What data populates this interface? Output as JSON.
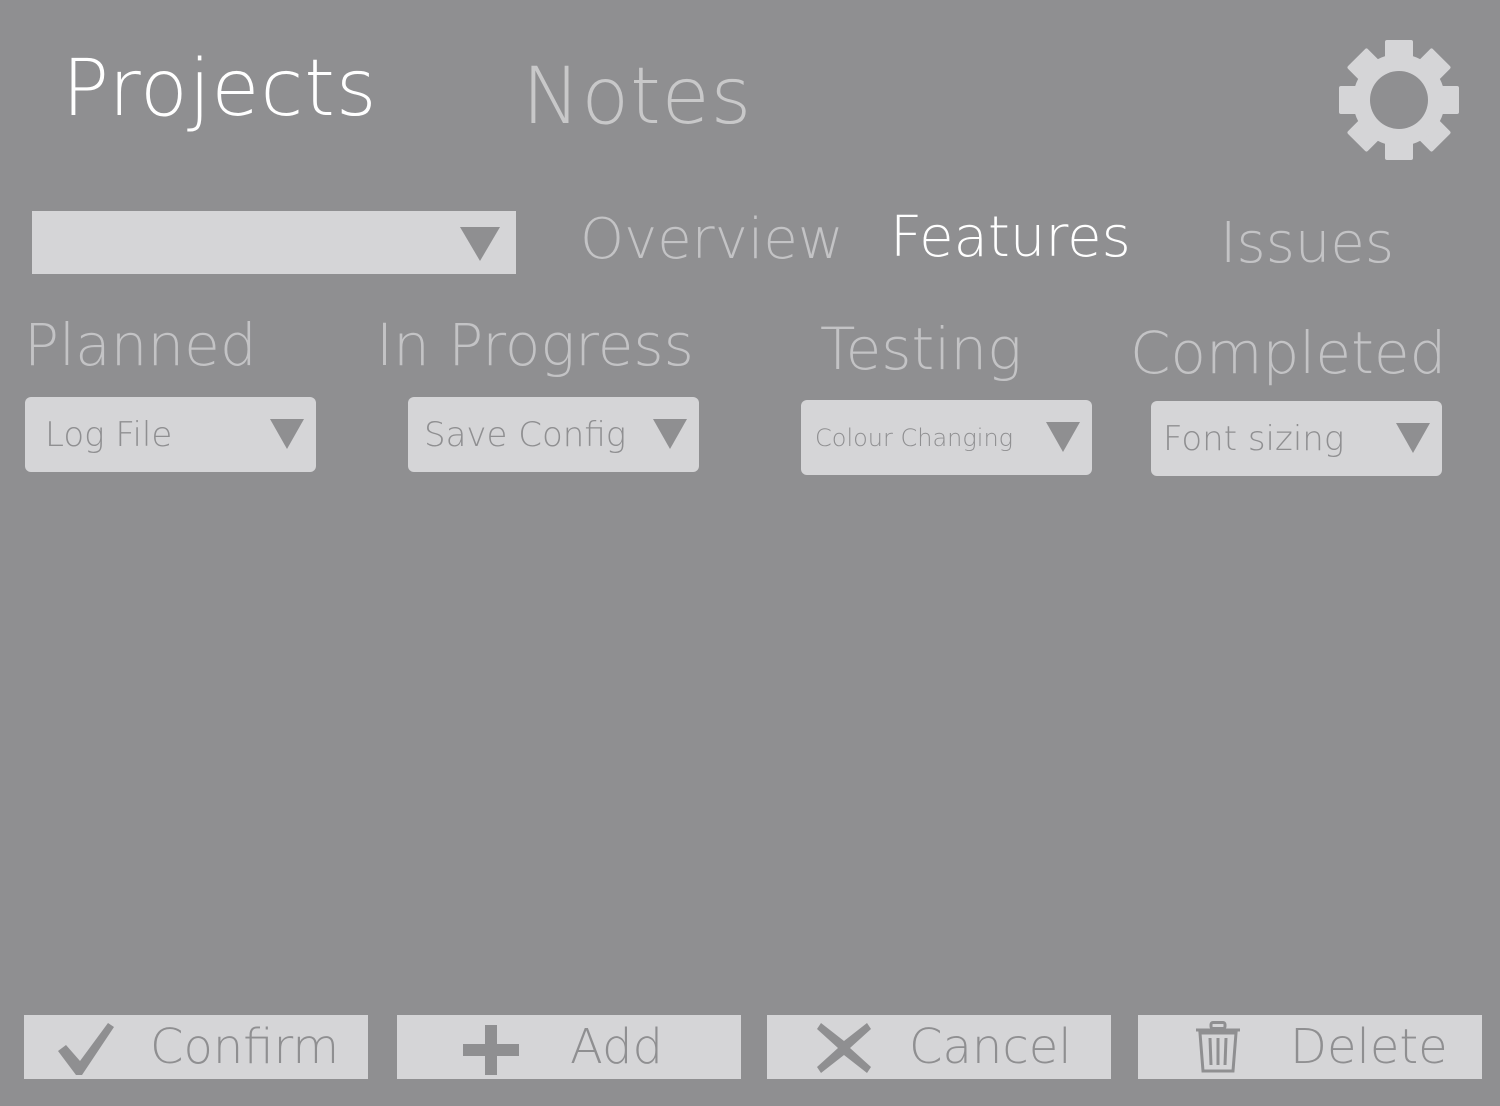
{
  "nav": {
    "projects_label": "Projects",
    "notes_label": "Notes",
    "settings_icon": "gear-icon"
  },
  "project_select": {
    "value": "",
    "icon": "dropdown-arrow-icon"
  },
  "sub_tabs": {
    "overview": "Overview",
    "features": "Features",
    "issues": "Issues",
    "active": "Features"
  },
  "columns": [
    {
      "header": "Planned",
      "selected": "Log File"
    },
    {
      "header": "In Progress",
      "selected": "Save Config"
    },
    {
      "header": "Testing",
      "selected": "Colour Changing"
    },
    {
      "header": "Completed",
      "selected": "Font sizing"
    }
  ],
  "actions": {
    "confirm_label": "Confirm",
    "confirm_icon": "checkmark-icon",
    "add_label": "Add",
    "add_icon": "plus-icon",
    "cancel_label": "Cancel",
    "cancel_icon": "x-icon",
    "delete_label": "Delete",
    "delete_icon": "trash-icon"
  },
  "colors": {
    "background": "#8f8f91",
    "control": "#d5d5d7",
    "active_text": "#ffffff",
    "inactive_text": "#c3c3c5",
    "icon": "#8f8f91"
  }
}
